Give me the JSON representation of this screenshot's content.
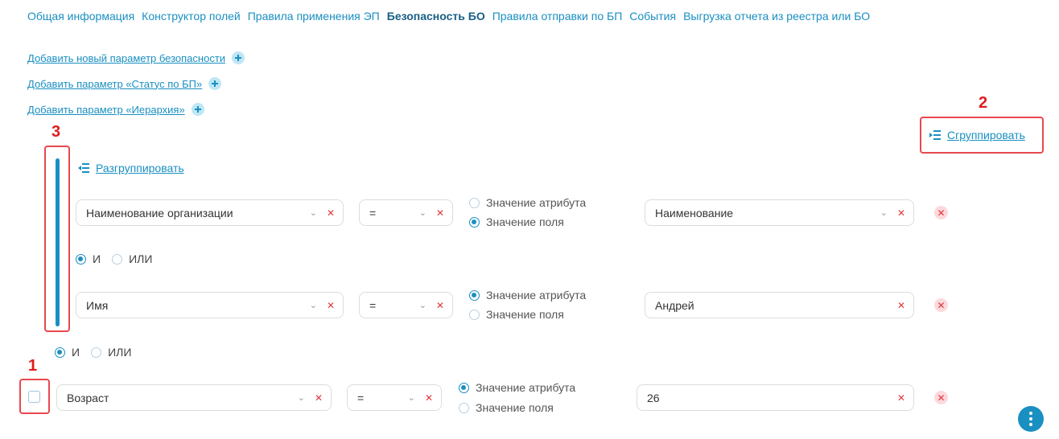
{
  "tabs": [
    {
      "label": "Общая информация"
    },
    {
      "label": "Конструктор полей"
    },
    {
      "label": "Правила применения ЭП"
    },
    {
      "label": "Безопасность БО"
    },
    {
      "label": "Правила отправки по БП"
    },
    {
      "label": "События"
    },
    {
      "label": "Выгрузка отчета из реестра или БО"
    }
  ],
  "add_links": [
    {
      "label": "Добавить новый параметр безопасности"
    },
    {
      "label": "Добавить параметр «Статус по БП»"
    },
    {
      "label": "Добавить параметр «Иерархия»"
    }
  ],
  "markers": {
    "m1": "1",
    "m2": "2",
    "m3": "3"
  },
  "group_button": "Сгруппировать",
  "ungroup_button": "Разгруппировать",
  "logic": {
    "and": "И",
    "or": "ИЛИ"
  },
  "radio_labels": {
    "attr": "Значение атрибута",
    "field": "Значение поля"
  },
  "rows": [
    {
      "field": "Наименование организации",
      "op": "=",
      "value": "Наименование",
      "value_mode": "field"
    },
    {
      "field": "Имя",
      "op": "=",
      "value": "Андрей",
      "value_mode": "attr"
    },
    {
      "field": "Возраст",
      "op": "=",
      "value": "26",
      "value_mode": "attr"
    }
  ],
  "logic_selected": [
    "and",
    "and"
  ],
  "icons": {
    "chevron": "chevron-down-icon",
    "clear": "clear-x-icon",
    "delete": "delete-row-icon",
    "fab": "more-vertical-icon"
  },
  "colors": {
    "accent": "#1a8fc1",
    "marker": "#e01b1b",
    "danger": "#e0363c"
  }
}
